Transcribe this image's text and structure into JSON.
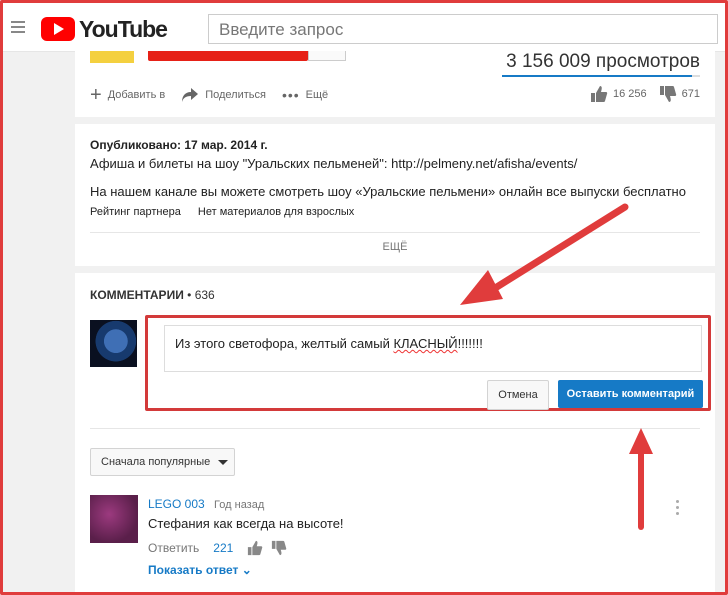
{
  "header": {
    "logo_text": "YouTube",
    "search_placeholder": "Введите запрос"
  },
  "video": {
    "views": "3 156 009 просмотров",
    "view_bar_fill": 0.96,
    "actions": {
      "add": "Добавить в",
      "share": "Поделиться",
      "more": "Ещё"
    },
    "likes": "16 256",
    "dislikes": "671"
  },
  "description": {
    "published": "Опубликовано: 17 мар. 2014 г.",
    "line1": "Афиша и билеты на шоу \"Уральских пельменей\": http://pelmeny.net/afisha/events/",
    "line2": "На нашем канале вы можете смотреть шоу «Уральские пельмени» онлайн все выпуски бесплатно",
    "rating_label": "Рейтинг партнера",
    "adult_label": "Нет материалов для взрослых",
    "more_label": "ЕЩЁ"
  },
  "comments": {
    "header_label": "КОММЕНТАРИИ",
    "header_count": "• 636",
    "draft_text_before": "Из этого светофора, желтый самый ",
    "draft_text_underlined": "КЛАСНЫЙ",
    "draft_text_after": "!!!!!!!",
    "cancel_label": "Отмена",
    "post_label": "Оставить комментарий",
    "sort_label": "Сначала популярные",
    "items": [
      {
        "author": "LEGO 003",
        "time": "Год назад",
        "text": "Стефания как всегда на высоте!",
        "reply_label": "Ответить",
        "like_count": "221",
        "show_replies": "Показать ответ"
      }
    ]
  },
  "colors": {
    "annotation_red": "#e03c3c",
    "accent_blue": "#167ac6",
    "brand_red": "#ff0000"
  }
}
